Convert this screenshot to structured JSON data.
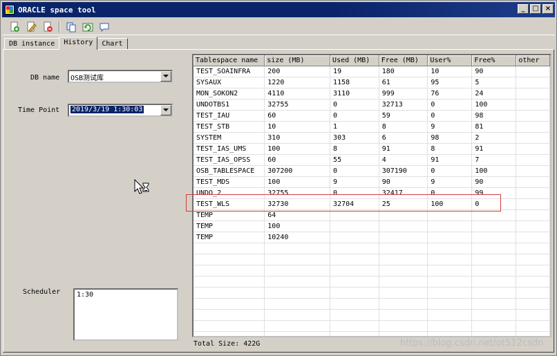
{
  "window": {
    "title": "ORACLE space tool",
    "controls": [
      "_",
      "□",
      "×"
    ]
  },
  "toolbar": {
    "icons": [
      "new-icon",
      "edit-icon",
      "delete-icon",
      "copy-icon",
      "refresh-icon",
      "comment-icon"
    ]
  },
  "tabs": [
    {
      "label": "DB instance",
      "active": false
    },
    {
      "label": "History",
      "active": true
    },
    {
      "label": "Chart",
      "active": false
    }
  ],
  "form": {
    "db_name_label": "DB name",
    "db_name_value": "OSB测试库",
    "time_point_label": "Time Point",
    "time_point_value": "2019/3/19 1:30:03",
    "scheduler_label": "Scheduler",
    "scheduler_value": "1:30"
  },
  "grid": {
    "columns": [
      "Tablespace name",
      "size (MB)",
      "Used (MB)",
      "Free (MB)",
      "User%",
      "Free%",
      "other"
    ],
    "rows": [
      [
        "TEST_SOAINFRA",
        "200",
        "19",
        "180",
        "10",
        "90",
        ""
      ],
      [
        "SYSAUX",
        "1220",
        "1158",
        "61",
        "95",
        "5",
        ""
      ],
      [
        "MON_SOKON2",
        "4110",
        "3110",
        "999",
        "76",
        "24",
        ""
      ],
      [
        "UNDOTBS1",
        "32755",
        "0",
        "32713",
        "0",
        "100",
        ""
      ],
      [
        "TEST_IAU",
        "60",
        "0",
        "59",
        "0",
        "98",
        ""
      ],
      [
        "TEST_STB",
        "10",
        "1",
        "8",
        "9",
        "81",
        ""
      ],
      [
        "SYSTEM",
        "310",
        "303",
        "6",
        "98",
        "2",
        ""
      ],
      [
        "TEST_IAS_UMS",
        "100",
        "8",
        "91",
        "8",
        "91",
        ""
      ],
      [
        "TEST_IAS_OPSS",
        "60",
        "55",
        "4",
        "91",
        "7",
        ""
      ],
      [
        "OSB_TABLESPACE",
        "307200",
        "0",
        "307190",
        "0",
        "100",
        ""
      ],
      [
        "TEST_MDS",
        "100",
        "9",
        "90",
        "9",
        "90",
        ""
      ],
      [
        "UNDO_2",
        "32755",
        "0",
        "32417",
        "0",
        "99",
        ""
      ],
      [
        "TEST_WLS",
        "32730",
        "32704",
        "25",
        "100",
        "0",
        ""
      ],
      [
        "TEMP",
        "64",
        "",
        "",
        "",
        "",
        ""
      ],
      [
        "TEMP",
        "100",
        "",
        "",
        "",
        "",
        ""
      ],
      [
        "TEMP",
        "10240",
        "",
        "",
        "",
        "",
        ""
      ]
    ],
    "empty_rows": 9,
    "highlighted_row": 12
  },
  "footer": {
    "total_size": "Total Size: 422G"
  },
  "watermark": "https://blog.csdn.net/ot512csdn",
  "colors": {
    "titlebar": "#0a246a",
    "selection": "#0a246a",
    "highlight_border": "#d83a3a"
  }
}
